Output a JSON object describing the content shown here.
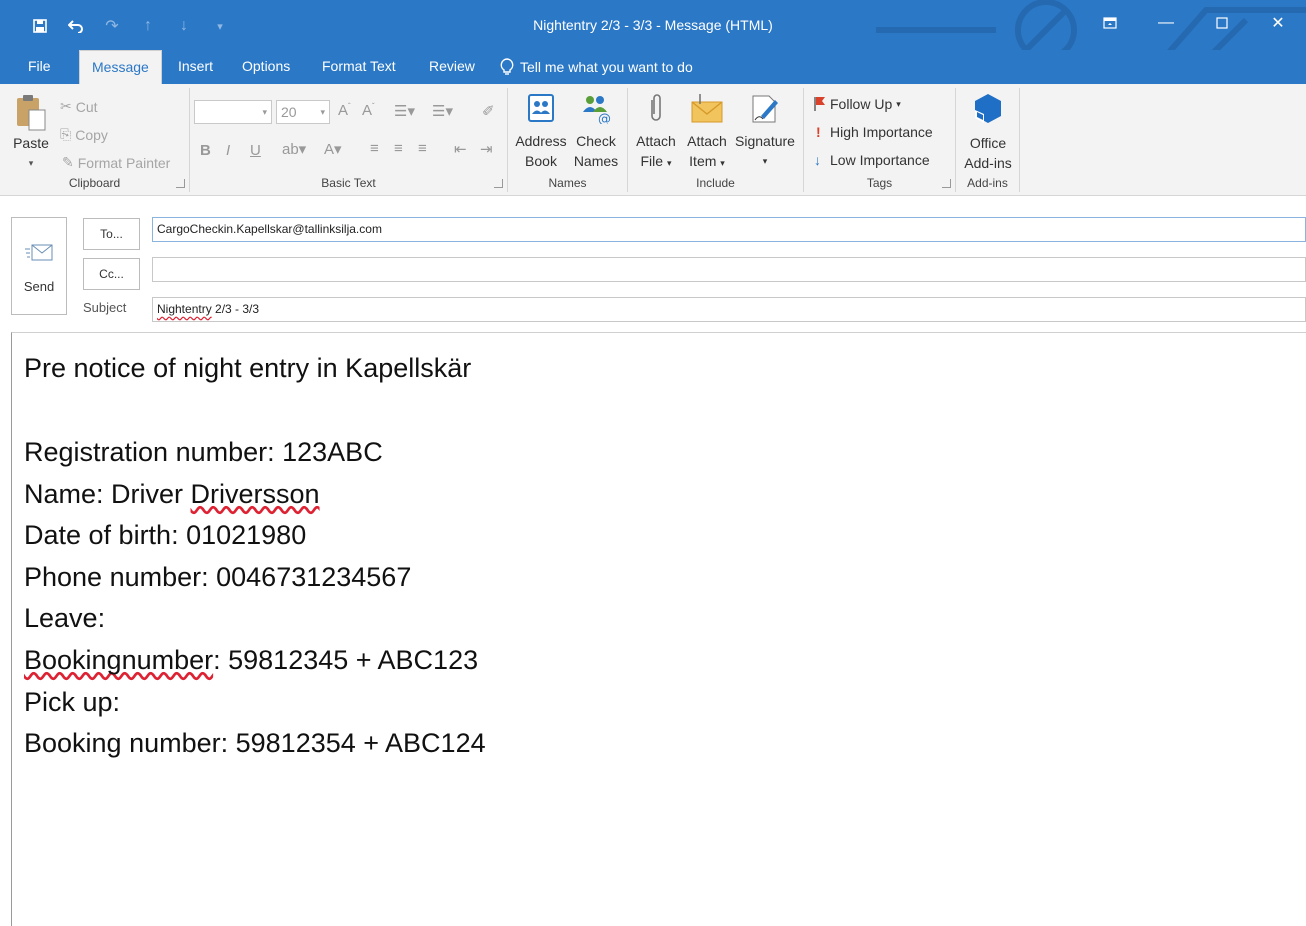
{
  "window": {
    "title": "Nightentry 2/3 - 3/3  -  Message (HTML)"
  },
  "tabs": [
    {
      "label": "File"
    },
    {
      "label": "Message"
    },
    {
      "label": "Insert"
    },
    {
      "label": "Options"
    },
    {
      "label": "Format Text"
    },
    {
      "label": "Review"
    }
  ],
  "tell_me": "Tell me what you want to do",
  "ribbon": {
    "clipboard": {
      "label": "Clipboard",
      "paste": "Paste",
      "cut": "Cut",
      "copy": "Copy",
      "format_painter": "Format Painter"
    },
    "basic_text": {
      "label": "Basic Text",
      "font_size": "20"
    },
    "names": {
      "label": "Names",
      "address_book_1": "Address",
      "address_book_2": "Book",
      "check_names_1": "Check",
      "check_names_2": "Names"
    },
    "include": {
      "label": "Include",
      "attach_file_1": "Attach",
      "attach_file_2": "File",
      "attach_item_1": "Attach",
      "attach_item_2": "Item",
      "signature": "Signature"
    },
    "tags": {
      "label": "Tags",
      "follow_up": "Follow Up",
      "high_importance": "High Importance",
      "low_importance": "Low Importance"
    },
    "addins": {
      "label": "Add-ins",
      "office_1": "Office",
      "office_2": "Add-ins"
    }
  },
  "compose": {
    "send_label": "Send",
    "to_label": "To...",
    "cc_label": "Cc...",
    "subject_label": "Subject",
    "to_value": "CargoCheckin.Kapellskar@tallinksilja.com",
    "cc_value": "",
    "subject_word": "Nightentry",
    "subject_rest": " 2/3 - 3/3"
  },
  "body": {
    "line1": "Pre notice of night entry in Kapellskär",
    "registration": "Registration number: 123ABC",
    "name_prefix": "Name: Driver ",
    "name_word": "Driversson",
    "dob": "Date of birth: 01021980",
    "phone": "Phone number: 0046731234567",
    "leave": "Leave:",
    "booking1_word": "Bookingnumber",
    "booking1_rest": ": 59812345 + ABC123",
    "pickup": "Pick up:",
    "booking2": "Booking number: 59812354 + ABC124"
  },
  "colors": {
    "titlebar": "#2b78c6",
    "ribbon": "#f3f3f3"
  }
}
